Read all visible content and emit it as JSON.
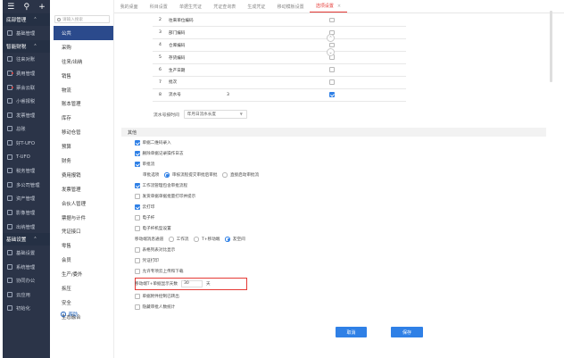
{
  "sidebar": {
    "top_icons": [
      "menu-icon",
      "search-icon",
      "plus-icon"
    ],
    "sections": [
      {
        "label": "底部管理",
        "items": [
          {
            "label": "基础管理"
          }
        ]
      },
      {
        "label": "智能财税",
        "items": [
          {
            "label": "往来对账"
          },
          {
            "label": "费用管理"
          },
          {
            "label": "票会云联"
          },
          {
            "label": "小睿报税"
          },
          {
            "label": "发票管理"
          },
          {
            "label": "总账"
          },
          {
            "label": "好T-UFO"
          },
          {
            "label": "T-UFO"
          },
          {
            "label": "税务管理"
          },
          {
            "label": "多公司管理"
          },
          {
            "label": "资产管理"
          },
          {
            "label": "影像管理"
          },
          {
            "label": "出纳管理"
          }
        ]
      },
      {
        "label": "基础设置",
        "items": [
          {
            "label": "基础设置"
          },
          {
            "label": "系统管理"
          },
          {
            "label": "协同办公"
          },
          {
            "label": "云应用"
          },
          {
            "label": "初始化"
          }
        ]
      }
    ]
  },
  "menu": {
    "search_placeholder": "请输入搜索",
    "items": [
      "公共",
      "采购",
      "往来/出纳",
      "销售",
      "物流",
      "账本管理",
      "库存",
      "移动仓管",
      "预算",
      "财务",
      "费用报销",
      "发票管理",
      "合伙人管理",
      "票据与计件",
      "凭证接口",
      "零售",
      "会员",
      "生产/委外",
      "拆压",
      "安全",
      "生态融合"
    ],
    "help": "帮助"
  },
  "tabs": [
    {
      "label": "我的桌面"
    },
    {
      "label": "科目设置"
    },
    {
      "label": "单据生凭证"
    },
    {
      "label": "凭证查询表"
    },
    {
      "label": "生成凭证"
    },
    {
      "label": "移动模板设置"
    },
    {
      "label": "选项设置",
      "active": true
    }
  ],
  "table": {
    "rows": [
      {
        "num": "2",
        "name": "往来单位编码",
        "value": "",
        "checked": false
      },
      {
        "num": "3",
        "name": "部门编码",
        "value": "",
        "checked": false
      },
      {
        "num": "4",
        "name": "仓库编码",
        "value": "",
        "checked": false
      },
      {
        "num": "5",
        "name": "存货编码",
        "value": "",
        "checked": false
      },
      {
        "num": "6",
        "name": "生产日期",
        "value": "",
        "checked": false
      },
      {
        "num": "7",
        "name": "批次",
        "value": "",
        "checked": false
      },
      {
        "num": "8",
        "name": "流水号",
        "value": "3",
        "checked": true
      }
    ]
  },
  "flow": {
    "label": "流水号按时间",
    "value": "年月日流水长度"
  },
  "other": {
    "title": "其他",
    "opt1": "单据二维码录入",
    "opt2": "删除单据记录操作日志",
    "opt3": "审批流",
    "radio_label": "审批选项",
    "radio1": "审核流程提交审批后审批",
    "radio2": "直接启动审批流",
    "opt4": "工作流管理包含审批流程",
    "opt5": "发货单据单据批量打印并提示",
    "opt6": "云打印",
    "opt7": "电子杆",
    "opt8": "电子杆机型设置",
    "notify_label": "移动端消息通道",
    "notify1": "工作流",
    "notify2": "T+移动端",
    "notify3": "友空间",
    "opt9": "表格列表对比显示",
    "opt10": "凭证打印",
    "opt11": "允许专项云上传和下载",
    "keep_label": "移动端T+单据显示天数",
    "keep_value": "30",
    "keep_unit": "天",
    "opt12": "单据附件控制已转出",
    "opt13": "隐藏审批人数统计"
  },
  "buttons": {
    "cancel": "取消",
    "save": "保存"
  },
  "colors": {
    "primary": "#2f80e6",
    "sidebar": "#2b3448",
    "active_tab": "#e53935",
    "menu_active": "#2b4a8c"
  }
}
